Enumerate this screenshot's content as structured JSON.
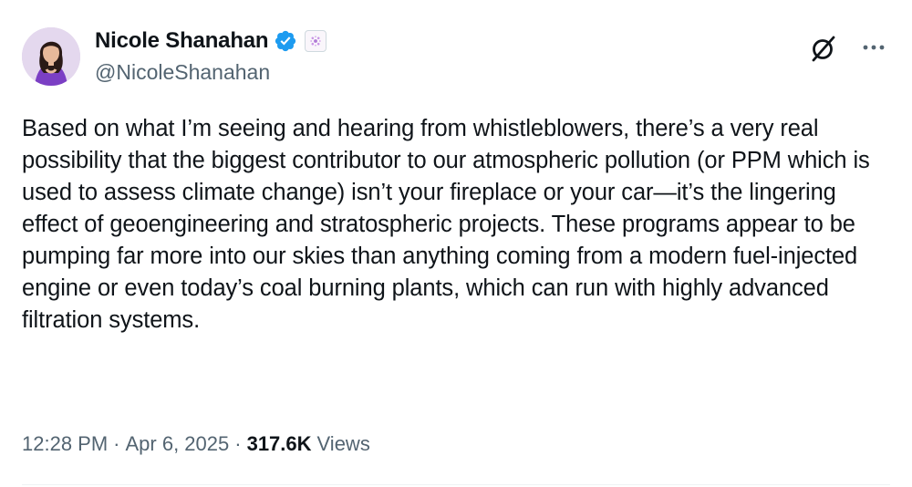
{
  "author": {
    "name": "Nicole Shanahan",
    "handle": "@NicoleShanahan",
    "verified_color": "#1d9bf0"
  },
  "tweet": {
    "text": "Based on what I’m seeing and hearing from whistleblowers, there’s a very real possibility that the biggest contributor to our atmospheric pollution (or PPM which is used to assess climate change) isn’t your fireplace or your car—it’s the lingering effect of geoengineering and stratospheric projects. These programs appear to be pumping far more into our skies than anything coming from a modern fuel-injected engine or even today’s coal burning plants, which can run with highly advanced filtration systems."
  },
  "meta": {
    "time": "12:28 PM",
    "date": "Apr 6, 2025",
    "views_count": "317.6K",
    "views_label": "Views"
  },
  "icons": {
    "grok": "grok-icon",
    "more": "more-dots-icon",
    "verified": "verified-badge-icon",
    "affiliation": "affiliation-badge-icon"
  },
  "colors": {
    "text": "#0f1419",
    "secondary": "#536471",
    "accent": "#1d9bf0"
  }
}
